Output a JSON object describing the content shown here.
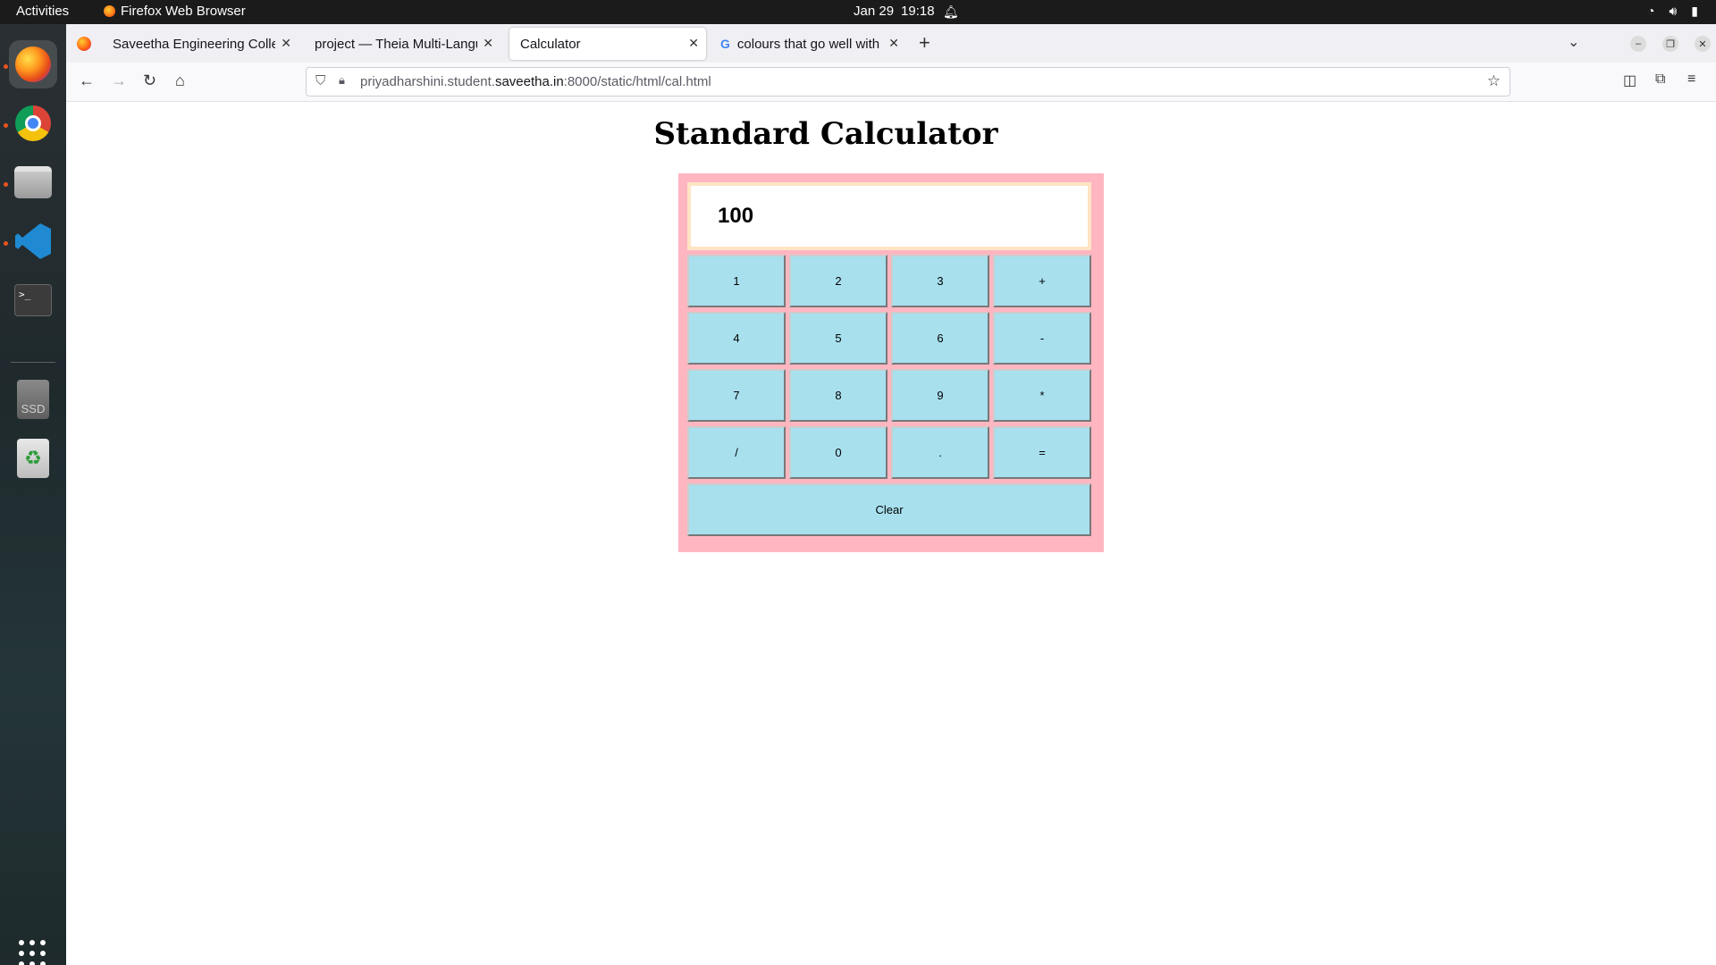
{
  "topbar": {
    "activities": "Activities",
    "app_name": "Firefox Web Browser",
    "date": "Jan 29",
    "time": "19:18"
  },
  "dock": {
    "items": [
      "firefox",
      "chrome",
      "files",
      "vscode",
      "terminal",
      "sd-card",
      "trash"
    ],
    "apps_grid": "show-applications"
  },
  "browser": {
    "tabs": [
      {
        "title": "Saveetha Engineering College",
        "active": false
      },
      {
        "title": "project — Theia Multi-Language",
        "active": false
      },
      {
        "title": "Calculator",
        "active": true
      },
      {
        "title": "colours that go well with",
        "active": false
      }
    ],
    "url_prefix": "priyadharshini.student.",
    "url_domain": "saveetha.in",
    "url_suffix": ":8000/static/html/cal.html"
  },
  "page": {
    "title": "Standard Calculator",
    "display_value": "100",
    "keys": [
      "1",
      "2",
      "3",
      "+",
      "4",
      "5",
      "6",
      "-",
      "7",
      "8",
      "9",
      "*",
      "/",
      "0",
      ".",
      "="
    ],
    "clear_label": "Clear"
  },
  "colors": {
    "calc_border": "#ffb6c1",
    "display_border": "#ffe4c4",
    "key_bg": "#a8e0ee"
  }
}
